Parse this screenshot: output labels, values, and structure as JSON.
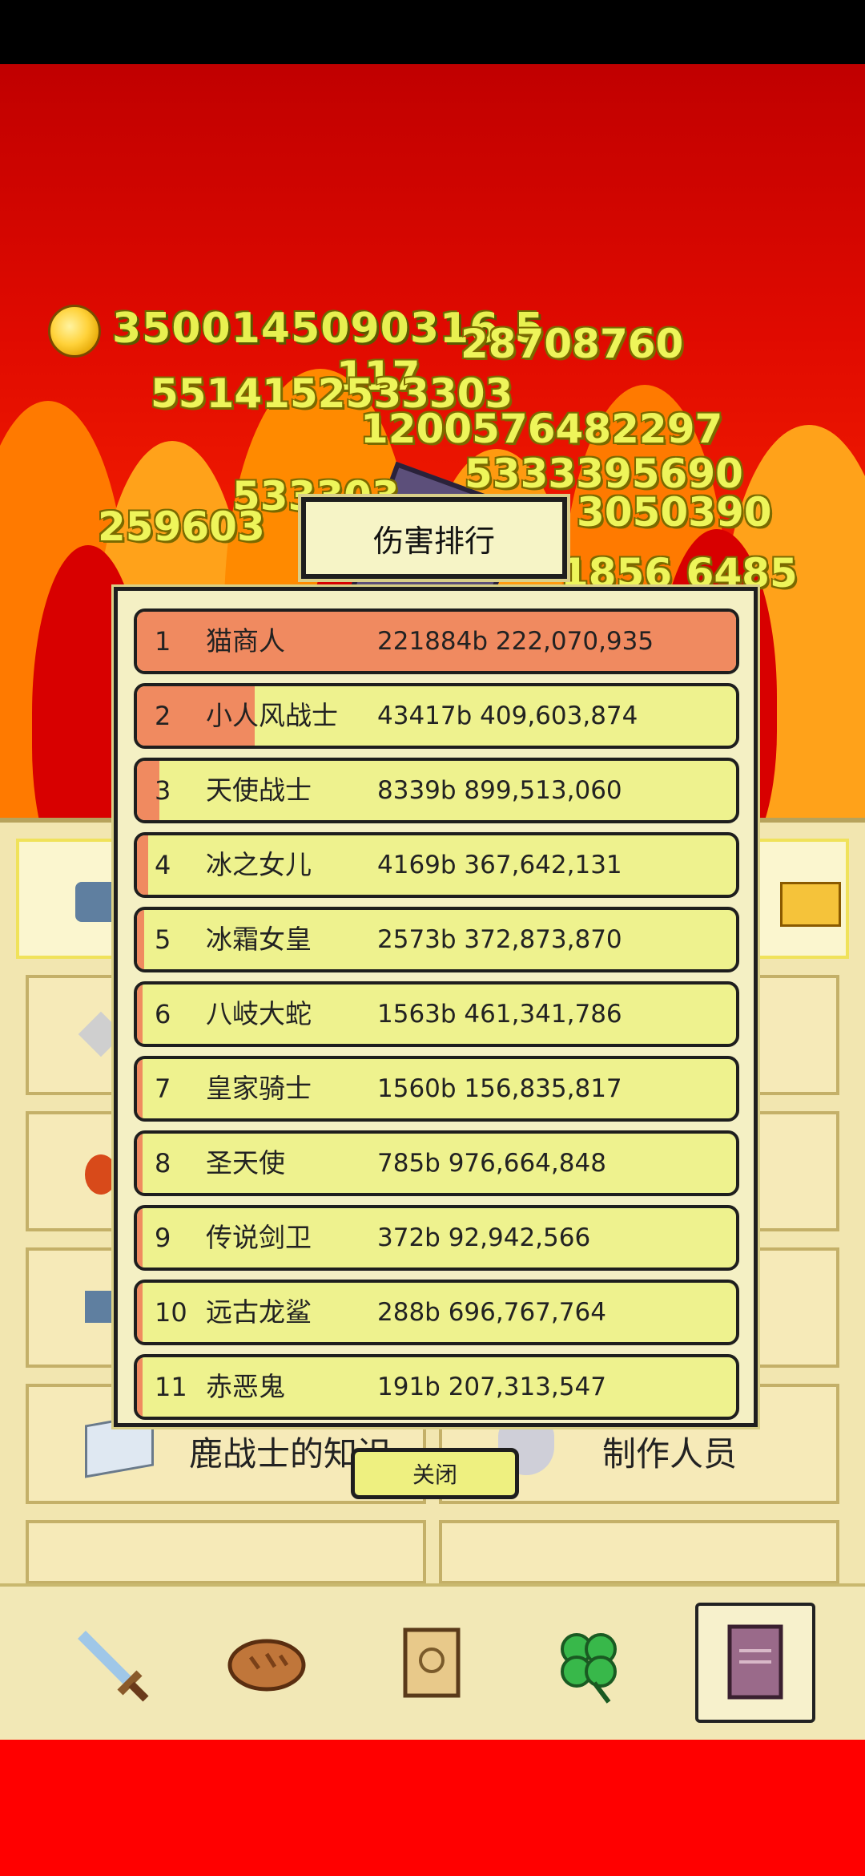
{
  "header": {
    "gold_amount": "3500145090316 5"
  },
  "damage_popups": [
    "28708760",
    "117",
    "5514152533303",
    "1200576482297",
    "5333395690",
    "533303",
    "259603",
    "3050390",
    "1856 6485"
  ],
  "menu": {
    "tiles": [
      {
        "label": "鹿战士的知识"
      },
      {
        "label": "制作人员"
      }
    ]
  },
  "dialog": {
    "title": "伤害排行",
    "rows": [
      {
        "rank": "1",
        "name": "猫商人",
        "damage": "221884b 222,070,935",
        "share": 1.0
      },
      {
        "rank": "2",
        "name": "小人风战士",
        "damage": "43417b 409,603,874",
        "share": 0.196
      },
      {
        "rank": "3",
        "name": "天使战士",
        "damage": "8339b 899,513,060",
        "share": 0.038
      },
      {
        "rank": "4",
        "name": "冰之女儿",
        "damage": "4169b 367,642,131",
        "share": 0.019
      },
      {
        "rank": "5",
        "name": "冰霜女皇",
        "damage": "2573b 372,873,870",
        "share": 0.012
      },
      {
        "rank": "6",
        "name": "八岐大蛇",
        "damage": "1563b 461,341,786",
        "share": 0.007
      },
      {
        "rank": "7",
        "name": "皇家骑士",
        "damage": "1560b 156,835,817",
        "share": 0.007
      },
      {
        "rank": "8",
        "name": "圣天使",
        "damage": "785b 976,664,848",
        "share": 0.0035
      },
      {
        "rank": "9",
        "name": "传说剑卫",
        "damage": "372b 92,942,566",
        "share": 0.0017
      },
      {
        "rank": "10",
        "name": "远古龙鲨",
        "damage": "288b 696,767,764",
        "share": 0.0013
      },
      {
        "rank": "11",
        "name": "赤恶鬼",
        "damage": "191b 207,313,547",
        "share": 0.0009
      }
    ],
    "close_label": "关闭"
  },
  "bottom_nav": {
    "items": [
      "sword-icon",
      "bread-icon",
      "scroll-icon",
      "clover-icon",
      "book-icon"
    ],
    "active": "book-icon"
  },
  "colors": {
    "bar_fill": "#f08a60",
    "row_bg": "#eef28e",
    "scene_red": "#e00a00"
  }
}
